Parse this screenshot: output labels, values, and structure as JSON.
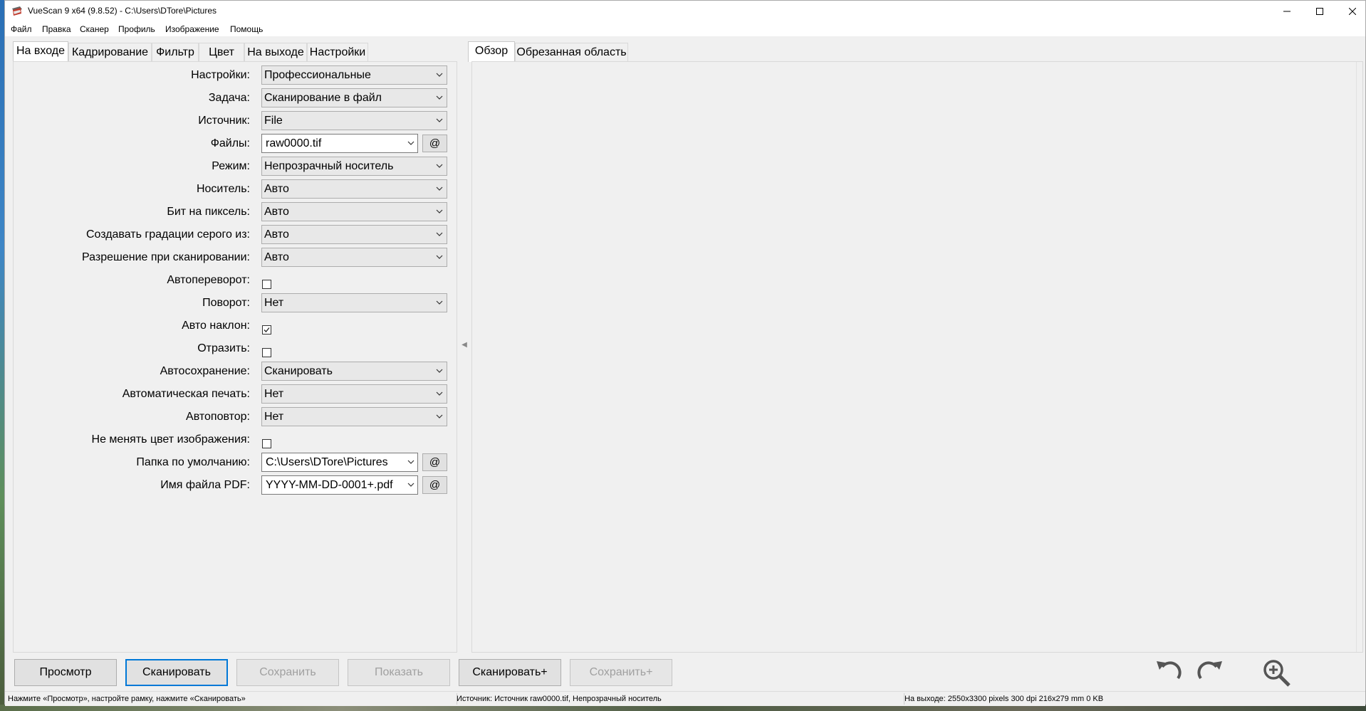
{
  "window": {
    "title": "VueScan 9 x64 (9.8.52) - C:\\Users\\DTore\\Pictures"
  },
  "menu": [
    "Файл",
    "Правка",
    "Сканер",
    "Профиль",
    "Изображение",
    "Помощь"
  ],
  "left_tabs": [
    "На входе",
    "Кадрирование",
    "Фильтр",
    "Цвет",
    "На выходе",
    "Настройки"
  ],
  "right_tabs": [
    "Обзор",
    "Обрезанная область"
  ],
  "form": {
    "settings_label": "Настройки:",
    "settings_value": "Профессиональные",
    "task_label": "Задача:",
    "task_value": "Сканирование в файл",
    "source_label": "Источник:",
    "source_value": "File",
    "files_label": "Файлы:",
    "files_value": "raw0000.tif",
    "mode_label": "Режим:",
    "mode_value": "Непрозрачный носитель",
    "media_label": "Носитель:",
    "media_value": "Авто",
    "bits_label": "Бит на пиксель:",
    "bits_value": "Авто",
    "gray_label": "Создавать градации серого из:",
    "gray_value": "Авто",
    "res_label": "Разрешение при сканировании:",
    "res_value": "Авто",
    "autoflip_label": "Автопереворот:",
    "rotate_label": "Поворот:",
    "rotate_value": "Нет",
    "autoskew_label": "Авто наклон:",
    "mirror_label": "Отразить:",
    "autosave_label": "Автосохранение:",
    "autosave_value": "Сканировать",
    "autoprint_label": "Автоматическая печать:",
    "autoprint_value": "Нет",
    "autorepeat_label": "Автоповтор:",
    "autorepeat_value": "Нет",
    "keepcolor_label": "Не менять цвет изображения:",
    "folder_label": "Папка по умолчанию:",
    "folder_value": "C:\\Users\\DTore\\Pictures",
    "pdfname_label": "Имя файла PDF:",
    "pdfname_value": "YYYY-MM-DD-0001+.pdf",
    "at_symbol": "@"
  },
  "checkboxes": {
    "autoflip": false,
    "autoskew": true,
    "mirror": false,
    "keepcolor": false
  },
  "buttons": {
    "preview": "Просмотр",
    "scan": "Сканировать",
    "save": "Сохранить",
    "show": "Показать",
    "scan_plus": "Сканировать+",
    "save_plus": "Сохранить+"
  },
  "status": {
    "left": "Нажмите «Просмотр», настройте рамку, нажмите «Сканировать»",
    "middle": "Источник: Источник raw0000.tif, Непрозрачный носитель",
    "right": "На выходе: 2550x3300 pixels 300 dpi 216x279 mm 0 KB"
  },
  "icons": [
    "app-icon",
    "minimize-icon",
    "maximize-icon",
    "close-icon",
    "chevron-down-icon",
    "checkmark-icon",
    "rotate-left-icon",
    "rotate-right-icon",
    "zoom-in-icon",
    "collapse-arrow-icon"
  ],
  "colors": {
    "accent": "#0078d7",
    "background": "#f0f0f0",
    "disabled_text": "#a0a0a0"
  }
}
